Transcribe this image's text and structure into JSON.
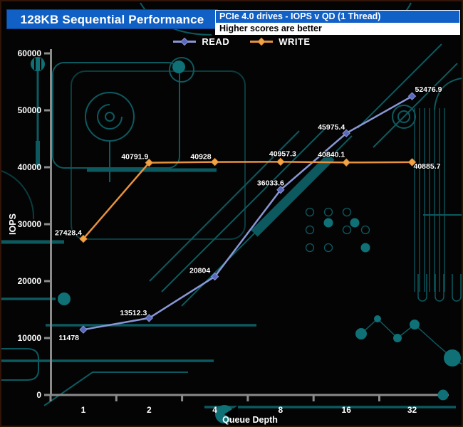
{
  "header": {
    "title": "128KB Sequential Performance",
    "subtitle": "PCIe 4.0 drives - IOPS v QD (1 Thread)",
    "note": "Higher scores are better"
  },
  "chart_data": {
    "type": "line",
    "title": "128KB Sequential Performance",
    "subtitle": "PCIe 4.0 drives - IOPS v QD (1 Thread)",
    "note": "Higher scores are better",
    "xlabel": "Queue Depth",
    "ylabel": "IOPS",
    "categories": [
      "1",
      "2",
      "4",
      "8",
      "16",
      "32"
    ],
    "ylim": [
      0,
      60000
    ],
    "y_tick_step": 10000,
    "y_tick_labels": [
      "60000",
      "50000",
      "40000",
      "30000",
      "20000",
      "10000",
      "0"
    ],
    "grid": false,
    "legend_position": "top-center",
    "axis_color": "#8a8a8a",
    "series": [
      {
        "name": "READ",
        "color": "#8a97d6",
        "marker_color": "#5a69bd",
        "marker": "diamond",
        "values": [
          11478,
          13512.3,
          20804,
          36033.6,
          45975.4,
          52476.9
        ],
        "labels": [
          "11478",
          "13512.3",
          "20804",
          "36033.6",
          "45975.4",
          "52476.9"
        ],
        "label_offsets": [
          [
            -6,
            15,
            "end"
          ],
          [
            -3,
            -4,
            "end"
          ],
          [
            -21,
            -5,
            "middle"
          ],
          [
            -14,
            -6,
            "middle"
          ],
          [
            -2,
            -5,
            "end"
          ],
          [
            4,
            -6,
            "start"
          ]
        ]
      },
      {
        "name": "WRITE",
        "color": "#e8923d",
        "marker_color": "#f2a445",
        "marker": "diamond",
        "values": [
          27428.4,
          40791.9,
          40928,
          40957.3,
          40840.1,
          40885.7
        ],
        "labels": [
          "27428.4",
          "40791.9",
          "40928",
          "40957.3",
          "40840.1",
          "40885.7"
        ],
        "label_offsets": [
          [
            -2,
            -5,
            "end"
          ],
          [
            -1,
            -5,
            "end"
          ],
          [
            -5,
            -4,
            "end"
          ],
          [
            3,
            -8,
            "middle"
          ],
          [
            -2,
            -8,
            "end"
          ],
          [
            2,
            9,
            "start"
          ]
        ]
      }
    ]
  },
  "theme": {
    "background": "#040404",
    "title_bg": "#1160c6",
    "circuit_color": "#0c5a60",
    "circuit_bright": "#0f7076",
    "frame_border": "#331409",
    "label_color": "#ffffff"
  }
}
